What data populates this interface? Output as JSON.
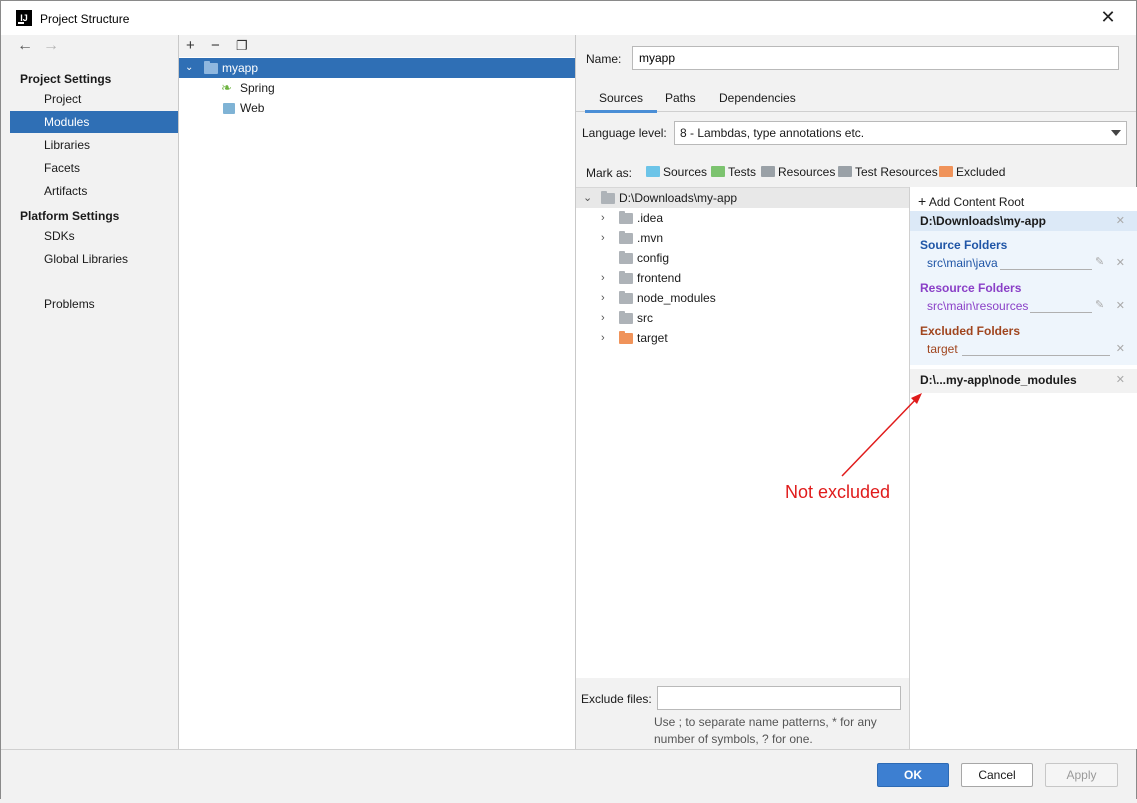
{
  "window": {
    "title": "Project Structure",
    "app_icon_text": "IJ"
  },
  "sidebar": {
    "project_settings_title": "Project Settings",
    "platform_settings_title": "Platform Settings",
    "items": [
      {
        "label": "Project"
      },
      {
        "label": "Modules"
      },
      {
        "label": "Libraries"
      },
      {
        "label": "Facets"
      },
      {
        "label": "Artifacts"
      },
      {
        "label": "SDKs"
      },
      {
        "label": "Global Libraries"
      },
      {
        "label": "Problems"
      }
    ],
    "selected": "Modules"
  },
  "modules": {
    "tree": [
      {
        "label": "myapp"
      },
      {
        "label": "Spring"
      },
      {
        "label": "Web"
      }
    ]
  },
  "module": {
    "name_label": "Name:",
    "name_value": "myapp",
    "tabs": [
      {
        "label": "Sources"
      },
      {
        "label": "Paths"
      },
      {
        "label": "Dependencies"
      }
    ],
    "language_level_label": "Language level:",
    "language_level_value": "8 - Lambdas, type annotations etc.",
    "mark_as_label": "Mark as:",
    "mark_as": [
      {
        "label": "Sources",
        "color": "#6cc4e8"
      },
      {
        "label": "Tests",
        "color": "#7cc36f"
      },
      {
        "label": "Resources",
        "color": "#9aa1a7"
      },
      {
        "label": "Test Resources",
        "color": "#9aa1a7"
      },
      {
        "label": "Excluded",
        "color": "#f0935a"
      }
    ]
  },
  "content_tree": {
    "root": "D:\\Downloads\\my-app",
    "children": [
      {
        "label": ".idea"
      },
      {
        "label": ".mvn"
      },
      {
        "label": "config"
      },
      {
        "label": "frontend"
      },
      {
        "label": "node_modules"
      },
      {
        "label": "src"
      },
      {
        "label": "target"
      }
    ]
  },
  "exclude": {
    "label": "Exclude files:",
    "value": "",
    "hint_line1": "Use ; to separate name patterns, * for any",
    "hint_line2": "number of symbols, ? for one."
  },
  "roots": {
    "add_label": "Add Content Root",
    "root1": "D:\\Downloads\\my-app",
    "source_title": "Source Folders",
    "source_path": "src\\main\\java",
    "resource_title": "Resource Folders",
    "resource_path": "src\\main\\resources",
    "excluded_title": "Excluded Folders",
    "excluded_path": "target",
    "root2": "D:\\...my-app\\node_modules"
  },
  "buttons": {
    "ok": "OK",
    "cancel": "Cancel",
    "apply": "Apply"
  },
  "annotation": {
    "text": "Not excluded",
    "color": "#e01b1b"
  },
  "colors": {
    "selection": "#2f6fb5",
    "source": "#1f55a6",
    "resource": "#8a3fc7",
    "excluded": "#a0451e"
  }
}
